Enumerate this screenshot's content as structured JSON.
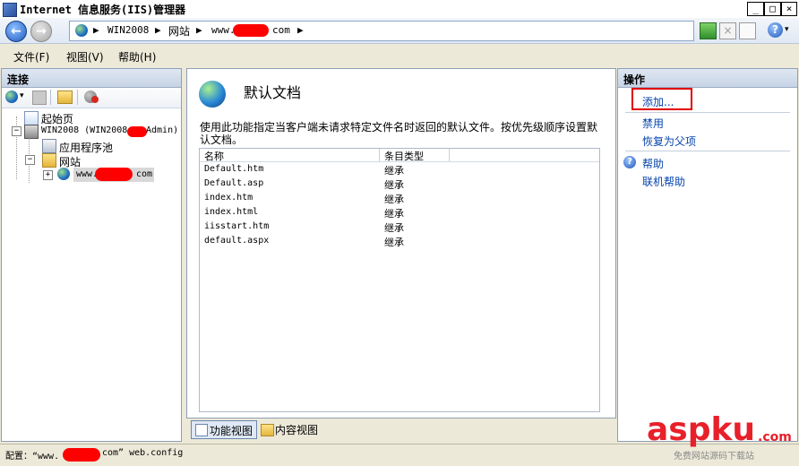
{
  "window": {
    "title": "Internet 信息服务(IIS)管理器",
    "minimize": "_",
    "maximize": "□",
    "close": "×"
  },
  "address": {
    "crumbs": [
      "WIN2008",
      "网站",
      "www.",
      "com"
    ],
    "separator": "▶"
  },
  "menu": {
    "items": [
      "文件(F)",
      "视图(V)",
      "帮助(H)"
    ]
  },
  "connections": {
    "header": "连接",
    "tree": {
      "start_page": "起始页",
      "server_prefix": "WIN2008 (WIN2008",
      "server_suffix": "Admin)",
      "app_pools": "应用程序池",
      "sites": "网站",
      "site_prefix": "www.",
      "site_suffix": "com"
    }
  },
  "center": {
    "title": "默认文档",
    "description_line1": "使用此功能指定当客户端未请求特定文件名时返回的默认文件。按优先级顺序设置默",
    "description_line2": "认文档。",
    "columns": [
      "名称",
      "条目类型"
    ],
    "rows": [
      {
        "name": "Default.htm",
        "type": "继承"
      },
      {
        "name": "Default.asp",
        "type": "继承"
      },
      {
        "name": "index.htm",
        "type": "继承"
      },
      {
        "name": "index.html",
        "type": "继承"
      },
      {
        "name": "iisstart.htm",
        "type": "继承"
      },
      {
        "name": "default.aspx",
        "type": "继承"
      }
    ],
    "features_view_tab": "功能视图",
    "content_view_tab": "内容视图"
  },
  "actions": {
    "header": "操作",
    "add": "添加...",
    "disable": "禁用",
    "revert": "恢复为父项",
    "help": "帮助",
    "online_help": "联机帮助"
  },
  "status": {
    "prefix": "配置：“www.",
    "suffix": "com” web.config"
  },
  "watermark": {
    "brand": "aspku",
    "tld": ".com",
    "tagline": "免费网站源码下载站"
  },
  "colors": {
    "highlight_box": "#e00000",
    "link": "#0645ad",
    "watermark_red": "#e8202a"
  }
}
